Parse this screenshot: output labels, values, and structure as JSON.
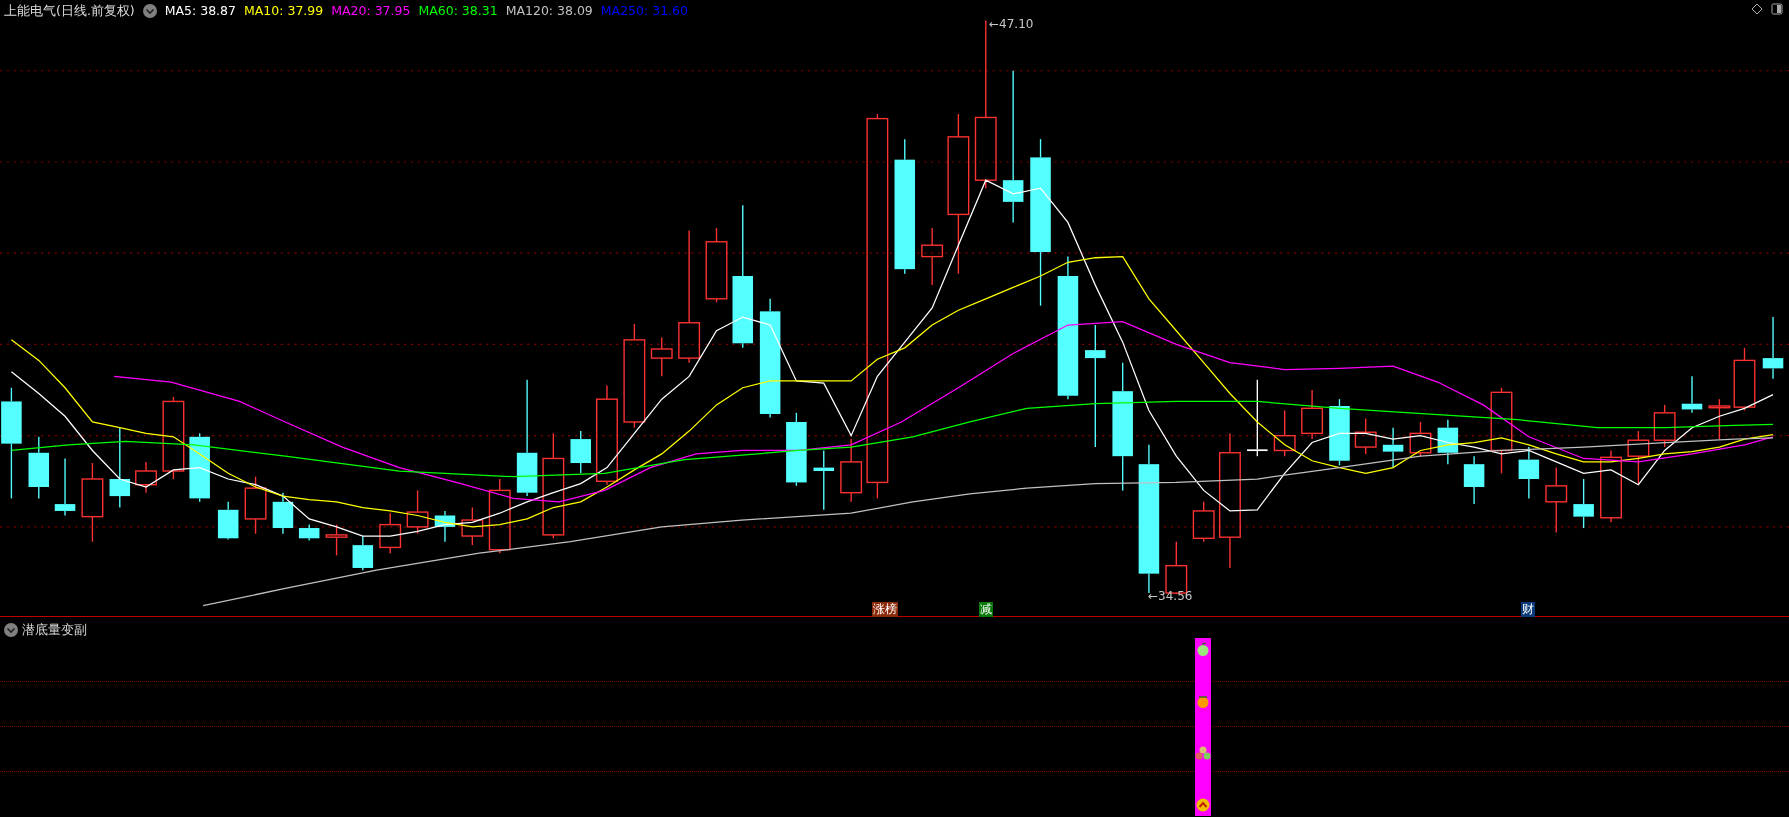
{
  "header": {
    "title": "上能电气(日线.前复权)"
  },
  "ma_legend": [
    {
      "label": "MA5: 38.87",
      "color": "#ffffff"
    },
    {
      "label": "MA10: 37.99",
      "color": "#ffff00"
    },
    {
      "label": "MA20: 37.95",
      "color": "#ff00ff"
    },
    {
      "label": "MA60: 38.31",
      "color": "#00ff00"
    },
    {
      "label": "MA120: 38.09",
      "color": "#c0c0c0"
    },
    {
      "label": "MA250: 31.60",
      "color": "#0000ff"
    }
  ],
  "price_labels": [
    {
      "kind": "high",
      "text": "←47.10"
    },
    {
      "kind": "low",
      "text": "←34.56"
    }
  ],
  "signal_badges": [
    {
      "text": "涨榜",
      "color": "#8b2b0b"
    },
    {
      "text": "减",
      "color": "#0a7a0a"
    },
    {
      "text": "财",
      "color": "#0b3a7a"
    }
  ],
  "lower_panel": {
    "title": "潜底量变副"
  }
}
